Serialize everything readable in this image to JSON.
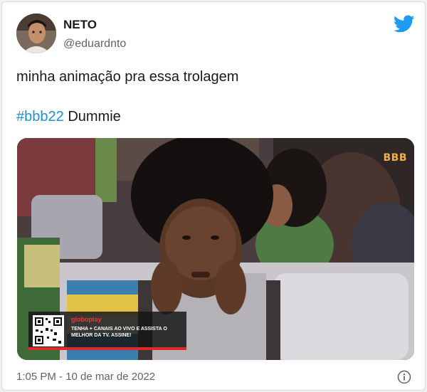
{
  "user": {
    "display_name": "NETO",
    "handle": "@eduardnto",
    "avatar_icon": "profile-photo"
  },
  "tweet": {
    "text": "minha animação pra essa trolagem",
    "hashtag": "#bbb22",
    "tag_text": "Dummie"
  },
  "media": {
    "channel_logo": "BBB",
    "ad_brand": "globoplay",
    "ad_copy": "TENHA + CANAIS AO VIVO E ASSISTA O MELHOR DA TV. ASSINE!"
  },
  "footer": {
    "timestamp": "1:05 PM - 10 de mar de 2022"
  },
  "colors": {
    "twitter_blue": "#1d9bf0",
    "hashtag_blue": "#1d8fd6",
    "ad_red": "#e02828"
  },
  "icons": {
    "brand": "twitter-bird-icon",
    "info": "info-icon"
  }
}
